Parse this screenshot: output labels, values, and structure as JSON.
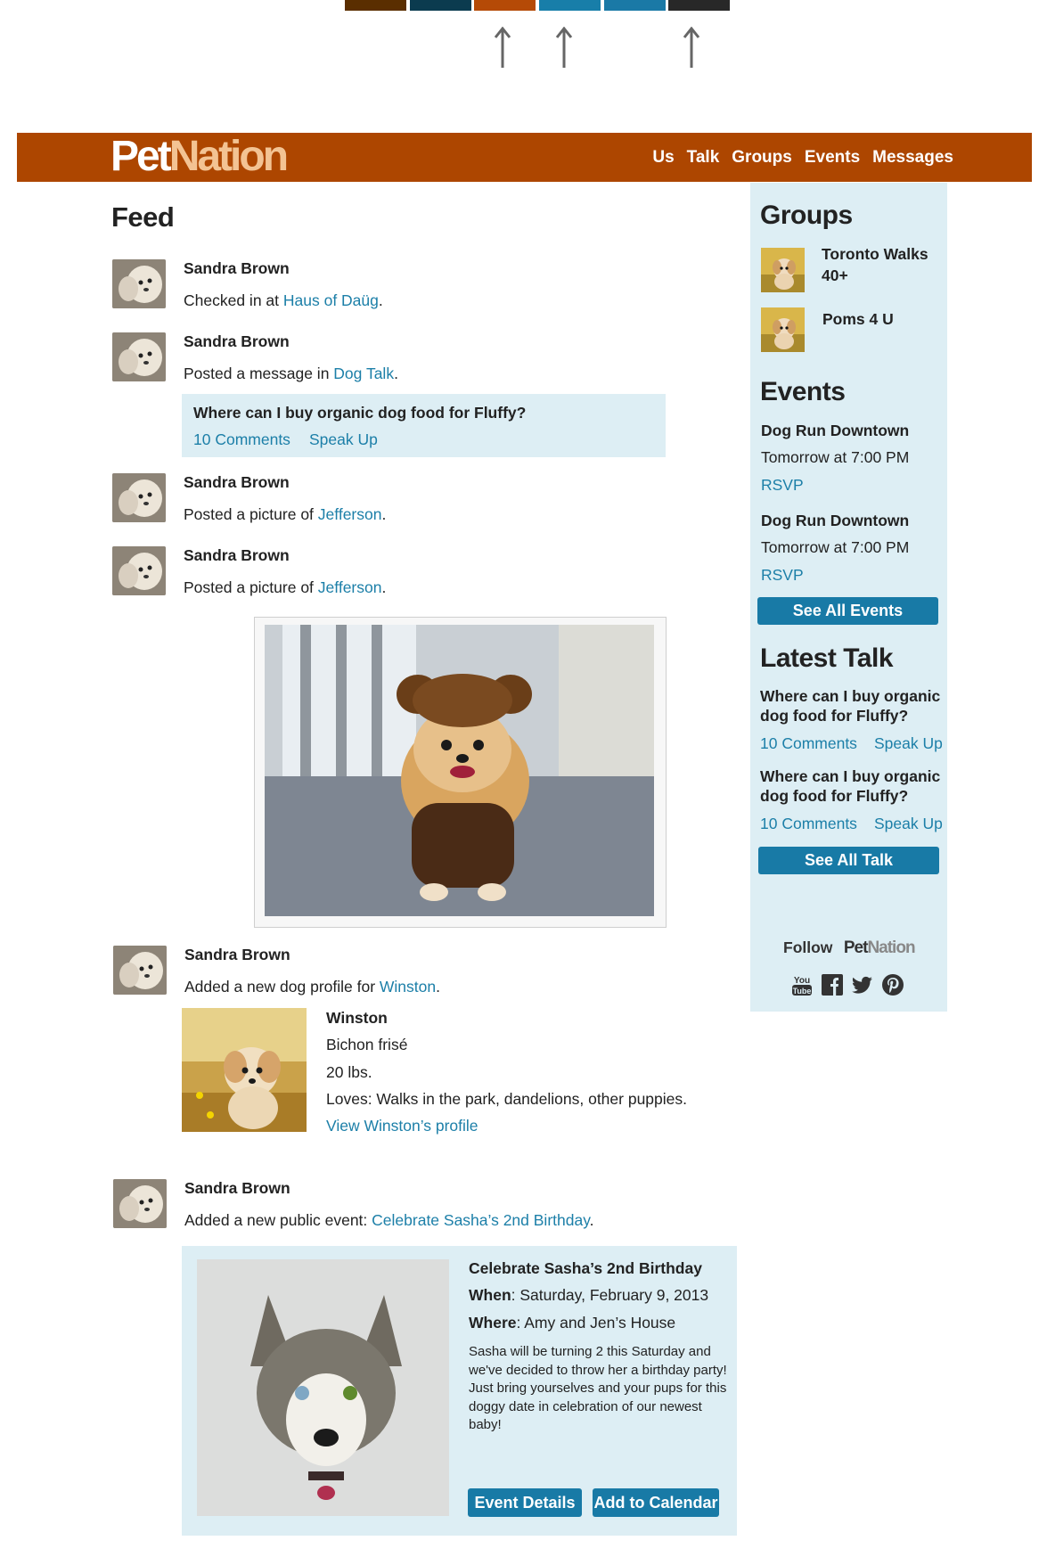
{
  "palette": {
    "colors": [
      "#5a2e00",
      "#0b3b4f",
      "#b54a06",
      "#187ea9",
      "#1a79a6",
      "#282828"
    ]
  },
  "header": {
    "logo_part1": "Pet",
    "logo_part2": "Nation",
    "nav": [
      "Us",
      "Talk",
      "Groups",
      "Events",
      "Messages"
    ]
  },
  "feed": {
    "title": "Feed",
    "items": [
      {
        "author": "Sandra Brown",
        "action_prefix": "Checked in at ",
        "link": "Haus of Daüg",
        "suffix": "."
      },
      {
        "author": "Sandra Brown",
        "action_prefix": "Posted a message in ",
        "link": "Dog Talk",
        "suffix": "."
      },
      {
        "author": "Sandra Brown",
        "action_prefix": "Posted a picture of ",
        "link": "Jefferson",
        "suffix": "."
      },
      {
        "author": "Sandra Brown",
        "action_prefix": "Posted a picture of ",
        "link": "Jefferson",
        "suffix": "."
      },
      {
        "author": "Sandra Brown",
        "action_prefix": "Added a new dog profile for ",
        "link": "Winston",
        "suffix": "."
      },
      {
        "author": "Sandra Brown",
        "action_prefix": "Added a new public event: ",
        "link": "Celebrate Sasha’s 2nd Birthday",
        "suffix": "."
      }
    ],
    "message": {
      "question": "Where can I buy organic dog food for Fluffy?",
      "comments": "10 Comments",
      "speak": "Speak Up"
    },
    "dog_profile": {
      "name": "Winston",
      "breed": "Bichon frisé",
      "weight": "20 lbs.",
      "loves": "Loves: Walks in the park, dandelions, other puppies.",
      "link": "View Winston’s profile"
    },
    "event": {
      "title": "Celebrate Sasha’s 2nd Birthday",
      "when_label": "When",
      "when": ": Saturday, February 9, 2013",
      "where_label": "Where",
      "where": ": Amy and Jen’s House",
      "description": "Sasha will be turning 2 this Saturday and we've decided to throw her a birthday party! Just bring yourselves and your pups for this doggy date in celebration of our newest baby!",
      "details_btn": "Event Details",
      "calendar_btn": "Add to Calendar"
    }
  },
  "sidebar": {
    "groups_title": "Groups",
    "groups": [
      "Toronto Walks",
      "40+",
      "Poms 4 U"
    ],
    "events_title": "Events",
    "events": [
      {
        "name": "Dog Run Downtown",
        "time": "Tomorrow at 7:00 PM",
        "rsvp": "RSVP"
      },
      {
        "name": "Dog Run Downtown",
        "time": "Tomorrow at 7:00 PM",
        "rsvp": "RSVP"
      }
    ],
    "see_all_events": "See All Events",
    "talk_title": "Latest Talk",
    "talk": [
      {
        "line1": "Where can I buy organic",
        "line2": "dog food for Fluffy?",
        "comments": "10 Comments",
        "speak": "Speak Up"
      },
      {
        "line1": "Where can I buy organic",
        "line2": "dog food for Fluffy?",
        "comments": "10 Comments",
        "speak": "Speak Up"
      }
    ],
    "see_all_talk": "See All Talk",
    "follow": "Follow",
    "follow_logo1": "Pet",
    "follow_logo2": "Nation",
    "social_icons": [
      "youtube-icon",
      "facebook-icon",
      "twitter-icon",
      "pinterest-icon"
    ]
  }
}
